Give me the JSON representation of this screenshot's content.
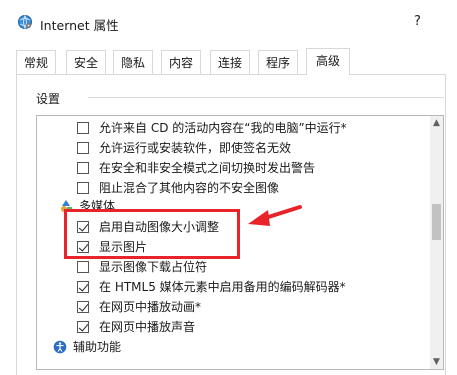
{
  "window": {
    "title": "Internet 属性",
    "help": "?"
  },
  "tabs": [
    {
      "label": "常规",
      "active": false
    },
    {
      "label": "安全",
      "active": false
    },
    {
      "label": "隐私",
      "active": false
    },
    {
      "label": "内容",
      "active": false
    },
    {
      "label": "连接",
      "active": false
    },
    {
      "label": "程序",
      "active": false
    },
    {
      "label": "高级",
      "active": true
    }
  ],
  "section": {
    "label": "设置"
  },
  "settings": [
    {
      "type": "checkbox",
      "label": "允许来自 CD 的活动内容在“我的电脑”中运行*",
      "checked": false
    },
    {
      "type": "checkbox",
      "label": "允许运行或安装软件，即使签名无效",
      "checked": false
    },
    {
      "type": "checkbox",
      "label": "在安全和非安全模式之间切换时发出警告",
      "checked": false
    },
    {
      "type": "checkbox",
      "label": "阻止混合了其他内容的不安全图像",
      "checked": false
    },
    {
      "type": "category",
      "label": "多媒体",
      "icon": "multimedia-icon"
    },
    {
      "type": "checkbox",
      "label": "启用自动图像大小调整",
      "checked": true
    },
    {
      "type": "checkbox",
      "label": "显示图片",
      "checked": true
    },
    {
      "type": "checkbox",
      "label": "显示图像下载占位符",
      "checked": false
    },
    {
      "type": "checkbox",
      "label": "在 HTML5 媒体元素中启用备用的编码解码器*",
      "checked": true
    },
    {
      "type": "checkbox",
      "label": "在网页中播放动画*",
      "checked": true
    },
    {
      "type": "checkbox",
      "label": "在网页中播放声音",
      "checked": true
    },
    {
      "type": "category",
      "label": "辅助功能",
      "icon": "accessibility-icon"
    }
  ],
  "annotation": {
    "color": "#e8232a"
  }
}
